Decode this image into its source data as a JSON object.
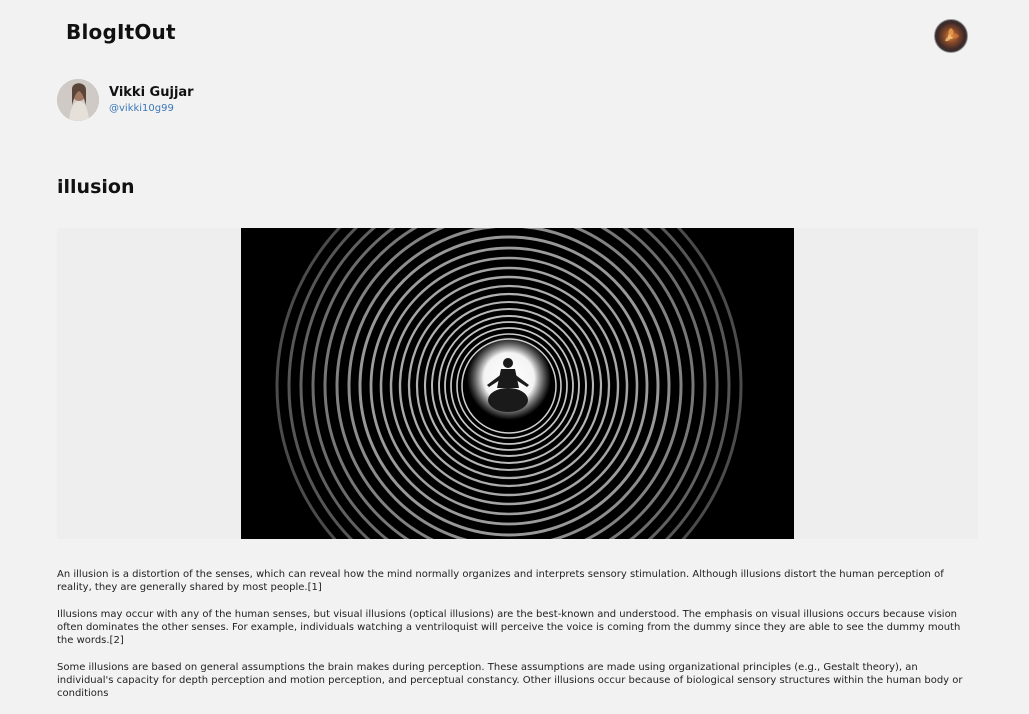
{
  "header": {
    "brand": "BlogItOut",
    "profile_icon": "profile-avatar-icon"
  },
  "author": {
    "name": "Vikki Gujjar",
    "handle": "@vikki10g99"
  },
  "post": {
    "title": "illusion",
    "image_icon": "tunnel-photo",
    "paragraphs": [
      "An illusion is a distortion of the senses, which can reveal how the mind normally organizes and interprets sensory stimulation. Although illusions distort the human perception of reality, they are generally shared by most people.[1]",
      "Illusions may occur with any of the human senses, but visual illusions (optical illusions) are the best-known and understood. The emphasis on visual illusions occurs because vision often dominates the other senses. For example, individuals watching a ventriloquist will perceive the voice is coming from the dummy since they are able to see the dummy mouth the words.[2]",
      "Some illusions are based on general assumptions the brain makes during perception. These assumptions are made using organizational principles (e.g., Gestalt theory), an individual's capacity for depth perception and motion perception, and perceptual constancy. Other illusions occur because of biological sensory structures within the human body or conditions"
    ]
  },
  "colors": {
    "background": "#f2f2f2",
    "handle": "#3b78b8",
    "text": "#222222"
  }
}
